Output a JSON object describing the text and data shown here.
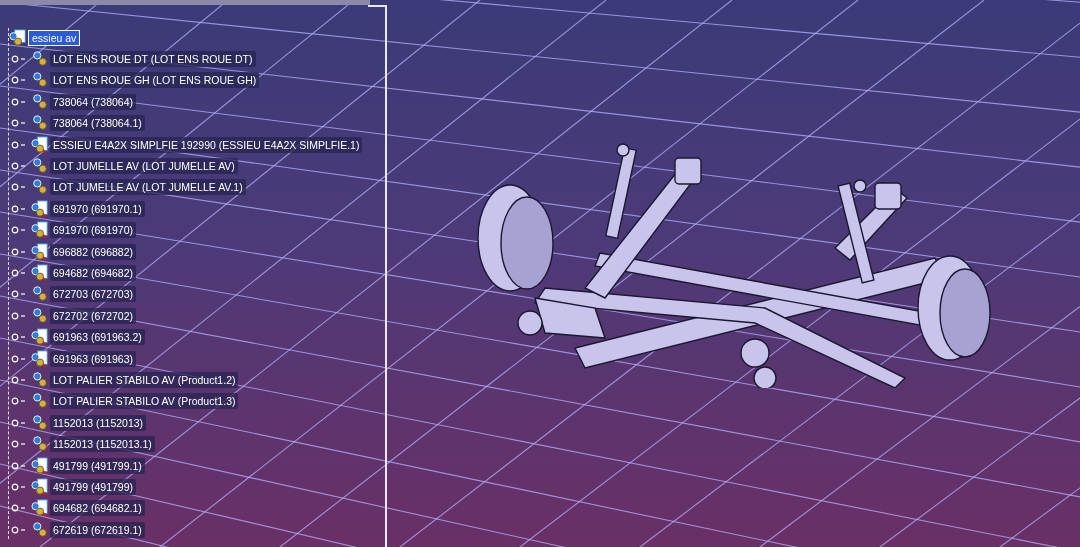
{
  "tree": {
    "root": {
      "label": "essieu av",
      "selected": true
    },
    "children": [
      {
        "label": "LOT ENS ROUE DT (LOT ENS ROUE DT)",
        "kind": "product",
        "selected": false
      },
      {
        "label": "LOT ENS ROUE GH (LOT ENS ROUE GH)",
        "kind": "product",
        "selected": false
      },
      {
        "label": "738064 (738064)",
        "kind": "product",
        "selected": false
      },
      {
        "label": "738064 (738064.1)",
        "kind": "product",
        "selected": false
      },
      {
        "label": "ESSIEU E4A2X SIMPLFIE 192990 (ESSIEU E4A2X SIMPLFIE.1)",
        "kind": "part",
        "selected": false
      },
      {
        "label": "LOT JUMELLE AV (LOT JUMELLE AV)",
        "kind": "product",
        "selected": false
      },
      {
        "label": "LOT JUMELLE AV (LOT JUMELLE AV.1)",
        "kind": "product",
        "selected": false
      },
      {
        "label": "691970 (691970.1)",
        "kind": "part",
        "selected": false
      },
      {
        "label": "691970 (691970)",
        "kind": "part",
        "selected": false
      },
      {
        "label": "696882 (696882)",
        "kind": "part",
        "selected": false
      },
      {
        "label": "694682 (694682)",
        "kind": "part",
        "selected": false
      },
      {
        "label": "672703 (672703)",
        "kind": "product",
        "selected": false
      },
      {
        "label": "672702 (672702)",
        "kind": "product",
        "selected": false
      },
      {
        "label": "691963 (691963.2)",
        "kind": "part",
        "selected": false
      },
      {
        "label": "691963 (691963)",
        "kind": "part",
        "selected": false
      },
      {
        "label": "LOT PALIER STABILO AV (Product1.2)",
        "kind": "product",
        "selected": false
      },
      {
        "label": "LOT PALIER STABILO AV (Product1.3)",
        "kind": "product",
        "selected": false
      },
      {
        "label": "1152013 (1152013)",
        "kind": "product",
        "selected": false
      },
      {
        "label": "1152013 (1152013.1)",
        "kind": "product",
        "selected": false
      },
      {
        "label": "491799 (491799.1)",
        "kind": "part",
        "selected": false
      },
      {
        "label": "491799 (491799)",
        "kind": "part",
        "selected": false
      },
      {
        "label": "694682 (694682.1)",
        "kind": "part",
        "selected": false
      },
      {
        "label": "672619 (672619.1)",
        "kind": "product",
        "selected": false
      }
    ]
  }
}
